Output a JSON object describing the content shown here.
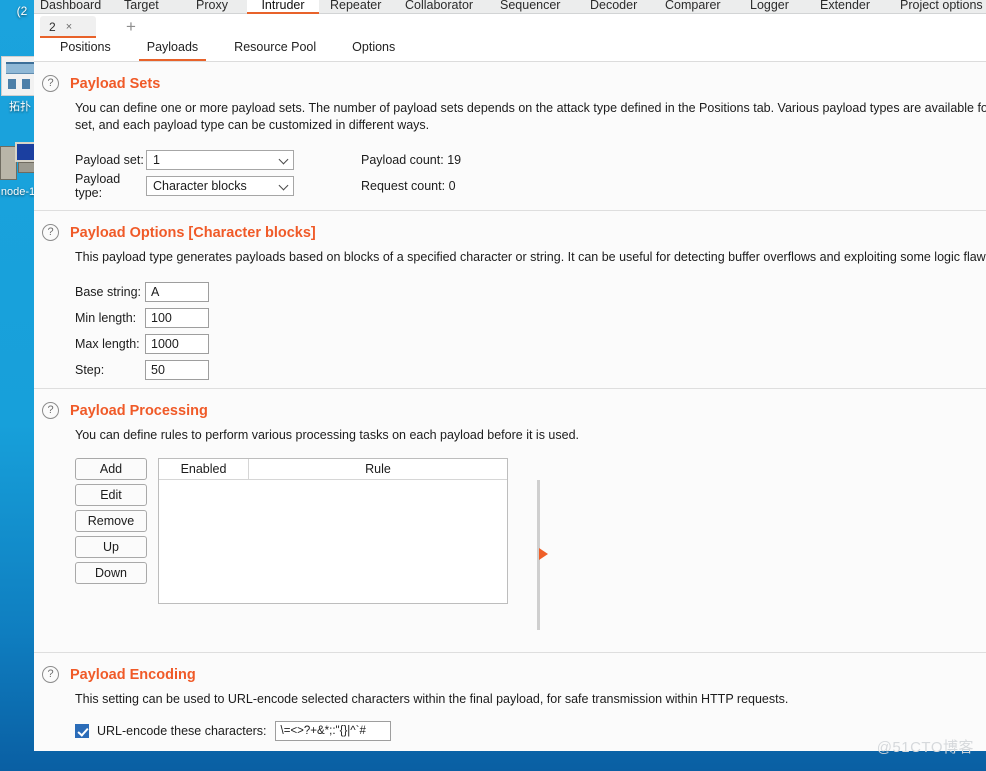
{
  "desktop": {
    "icons": [
      {
        "name": "network-places",
        "label": "拓扑"
      },
      {
        "name": "my-computer",
        "label": "node-1"
      }
    ],
    "overlay_text": "(2"
  },
  "watermark": "@51CTO博客",
  "topbar": {
    "tabs": [
      {
        "label": "Dashboard",
        "selected": false
      },
      {
        "label": "Target",
        "selected": false
      },
      {
        "label": "Proxy",
        "selected": false
      },
      {
        "label": "Intruder",
        "selected": true
      },
      {
        "label": "Repeater",
        "selected": false
      },
      {
        "label": "Collaborator",
        "selected": false
      },
      {
        "label": "Sequencer",
        "selected": false
      },
      {
        "label": "Decoder",
        "selected": false
      },
      {
        "label": "Comparer",
        "selected": false
      },
      {
        "label": "Logger",
        "selected": false
      },
      {
        "label": "Extender",
        "selected": false
      },
      {
        "label": "Project options",
        "selected": false
      }
    ]
  },
  "attack_tabs": {
    "current": "2",
    "close_label": "×",
    "new_tab_label": "+"
  },
  "subtabs": [
    {
      "label": "Positions",
      "selected": false
    },
    {
      "label": "Payloads",
      "selected": true
    },
    {
      "label": "Resource Pool",
      "selected": false
    },
    {
      "label": "Options",
      "selected": false
    }
  ],
  "payload_sets": {
    "help_icon": "?",
    "title": "Payload Sets",
    "description": "You can define one or more payload sets. The number of payload sets depends on the attack type defined in the Positions tab. Various payload types are available for each payload set, and each payload type can be customized in different ways.",
    "payload_set_label": "Payload set:",
    "payload_set_value": "1",
    "payload_type_label": "Payload type:",
    "payload_type_value": "Character blocks",
    "payload_count_label": "Payload count:",
    "payload_count_value": "19",
    "request_count_label": "Request count:",
    "request_count_value": "0"
  },
  "payload_options": {
    "help_icon": "?",
    "title": "Payload Options [Character blocks]",
    "description": "This payload type generates payloads based on blocks of a specified character or string. It can be useful for detecting buffer overflows and exploiting some logic flaws.",
    "fields": [
      {
        "label": "Base string:",
        "value": "A"
      },
      {
        "label": "Min length:",
        "value": "100"
      },
      {
        "label": "Max length:",
        "value": "1000"
      },
      {
        "label": "Step:",
        "value": "50"
      }
    ]
  },
  "payload_processing": {
    "help_icon": "?",
    "title": "Payload Processing",
    "description": "You can define rules to perform various processing tasks on each payload before it is used.",
    "buttons": [
      "Add",
      "Edit",
      "Remove",
      "Up",
      "Down"
    ],
    "columns": [
      "Enabled",
      "Rule"
    ],
    "rows": []
  },
  "payload_encoding": {
    "help_icon": "?",
    "title": "Payload Encoding",
    "description": "This setting can be used to URL-encode selected characters within the final payload, for safe transmission within HTTP requests.",
    "checkbox_checked": true,
    "checkbox_label": "URL-encode these characters:",
    "characters": "\\=<>?+&*;:\"{}|^`#"
  },
  "colors": {
    "accent": "#f05a28",
    "tab_underline": "#e8622a",
    "checkbox": "#2b6cb8",
    "desktop": "#1ba3dd"
  }
}
